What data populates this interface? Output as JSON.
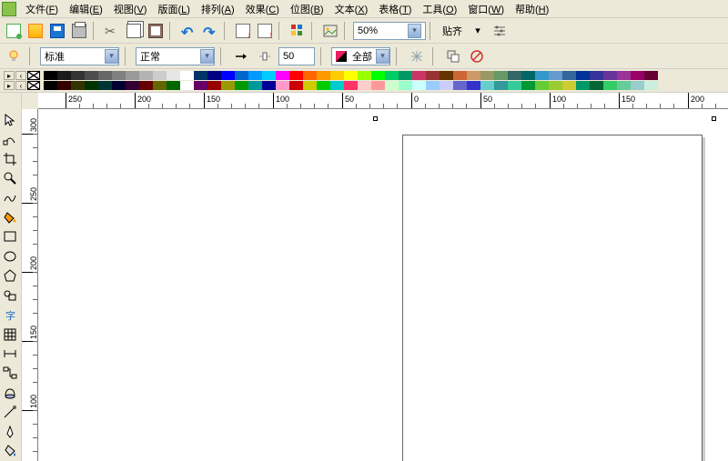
{
  "menubar": {
    "items": [
      {
        "label": "文件",
        "key": "F"
      },
      {
        "label": "编辑",
        "key": "E"
      },
      {
        "label": "视图",
        "key": "V"
      },
      {
        "label": "版面",
        "key": "L"
      },
      {
        "label": "排列",
        "key": "A"
      },
      {
        "label": "效果",
        "key": "C"
      },
      {
        "label": "位图",
        "key": "B"
      },
      {
        "label": "文本",
        "key": "X"
      },
      {
        "label": "表格",
        "key": "T"
      },
      {
        "label": "工具",
        "key": "O"
      },
      {
        "label": "窗口",
        "key": "W"
      },
      {
        "label": "帮助",
        "key": "H"
      }
    ]
  },
  "toolbar": {
    "zoom": "50%",
    "snap_label": "贴齐"
  },
  "propbar": {
    "style": "标准",
    "mode": "正常",
    "opacity": "50",
    "fill_scope": "全部"
  },
  "palette": {
    "row1": [
      "#000000",
      "#1a1a1a",
      "#333333",
      "#4d4d4d",
      "#666666",
      "#808080",
      "#999999",
      "#b3b3b3",
      "#cccccc",
      "#e6e6e6",
      "#ffffff",
      "#003366",
      "#000080",
      "#0000ff",
      "#0066cc",
      "#0099ff",
      "#00ccff",
      "#ff00ff",
      "#ff0000",
      "#ff6600",
      "#ff9900",
      "#ffcc00",
      "#ffff00",
      "#99ff00",
      "#00ff00",
      "#00cc66",
      "#009966",
      "#cc3366",
      "#993333",
      "#663300",
      "#cc6633",
      "#cc9966",
      "#999966",
      "#669966",
      "#336666",
      "#006666",
      "#3399cc",
      "#6699cc",
      "#336699",
      "#003399",
      "#333399",
      "#663399",
      "#993399",
      "#990066",
      "#660033"
    ],
    "row2": [
      "#000000",
      "#330000",
      "#333300",
      "#003300",
      "#003333",
      "#000033",
      "#330033",
      "#660000",
      "#666600",
      "#006600",
      "#ffffff",
      "#660066",
      "#990000",
      "#999900",
      "#009900",
      "#009999",
      "#000099",
      "#ff99cc",
      "#cc0000",
      "#cccc00",
      "#00cc00",
      "#00cccc",
      "#ff3366",
      "#ffcccc",
      "#ff9999",
      "#ccffcc",
      "#99ffcc",
      "#ccffff",
      "#99ccff",
      "#ccccff",
      "#6666cc",
      "#3333cc",
      "#66cccc",
      "#339999",
      "#33cc99",
      "#009933",
      "#66cc33",
      "#99cc33",
      "#cccc33",
      "#009966",
      "#006633",
      "#33cc66",
      "#66cc99",
      "#99cccc",
      "#cceedd"
    ]
  },
  "ruler": {
    "h_labels": [
      "250",
      "200",
      "150",
      "100",
      "50",
      "0",
      "50",
      "100",
      "150",
      "200"
    ],
    "v_labels": [
      "300",
      "250",
      "200",
      "150",
      "100"
    ]
  }
}
